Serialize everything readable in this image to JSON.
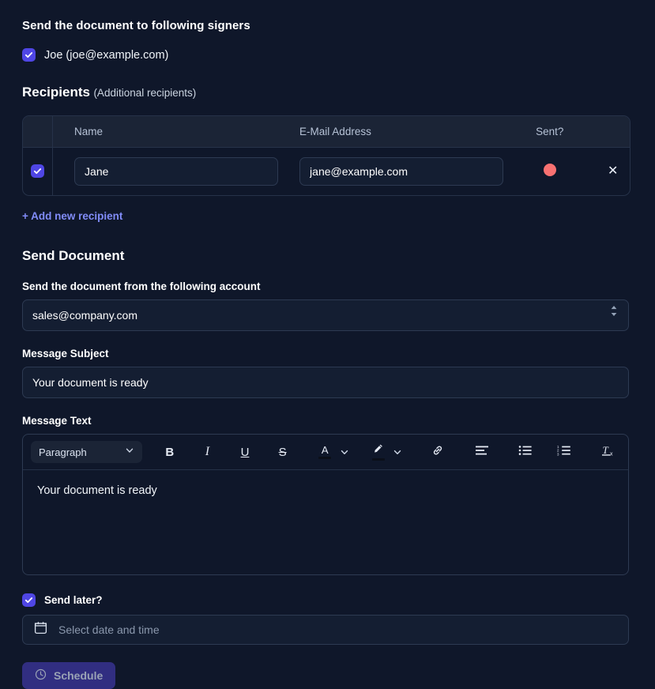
{
  "signers_section": {
    "heading": "Send the document to following signers",
    "signers": [
      {
        "label": "Joe (joe@example.com)",
        "checked": true
      }
    ]
  },
  "recipients_section": {
    "title": "Recipients",
    "subtitle": "(Additional recipients)",
    "columns": [
      "",
      "Name",
      "E-Mail Address",
      "Sent?",
      ""
    ],
    "rows": [
      {
        "checked": true,
        "name": "Jane",
        "email": "jane@example.com",
        "sent_status_color": "#f87171",
        "remove_icon": "close-icon"
      }
    ],
    "add_new_label": "+ Add new recipient"
  },
  "send_document": {
    "title": "Send Document",
    "account_label": "Send the document from the following account",
    "account_value": "sales@company.com",
    "account_options": [
      "sales@company.com"
    ],
    "subject_label": "Message Subject",
    "subject_value": "Your document is ready",
    "message_label": "Message Text",
    "message_body": "Your document is ready"
  },
  "editor_toolbar": {
    "block_format": "Paragraph",
    "buttons": [
      {
        "name": "bold-button",
        "glyph": "B"
      },
      {
        "name": "italic-button",
        "glyph": "I"
      },
      {
        "name": "underline-button",
        "glyph": "U"
      },
      {
        "name": "strikethrough-button",
        "glyph": "S"
      }
    ],
    "text_color": {
      "glyph": "A",
      "swatch": "#0b0f19"
    },
    "highlight_color": {
      "icon": "pen-icon",
      "swatch": "#0b0f19"
    },
    "link_icon": "link-icon",
    "align_icon": "align-left-icon",
    "bullet_list_icon": "bullet-list-icon",
    "ordered_list_icon": "ordered-list-icon",
    "clear_format_icon": "clear-formatting-icon"
  },
  "schedule": {
    "send_later_label": "Send later?",
    "send_later_checked": true,
    "datetime_value": "",
    "datetime_placeholder": "Select date and time",
    "calendar_icon": "calendar-icon",
    "button_label": "Schedule",
    "button_icon": "clock-icon"
  },
  "theme": {
    "background": "#0f172a",
    "accent": "#4f46e5",
    "link": "#818cf8",
    "status_red": "#f87171",
    "button_bg": "#312e81"
  }
}
